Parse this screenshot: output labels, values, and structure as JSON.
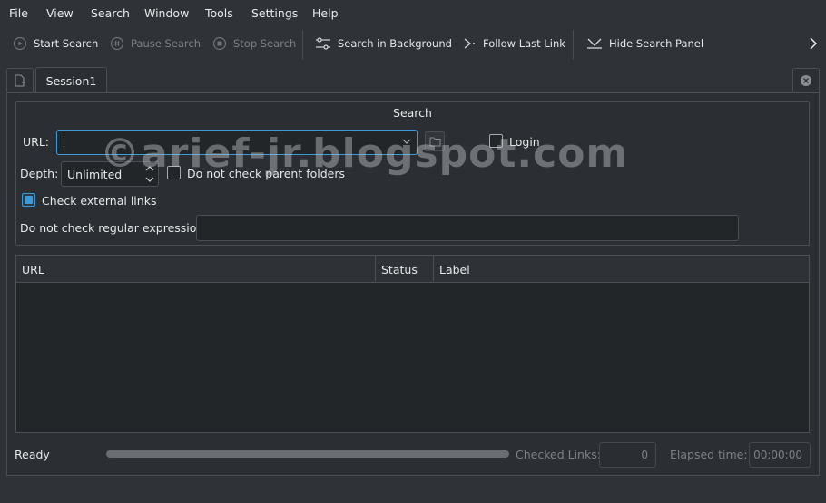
{
  "menu": [
    "File",
    "View",
    "Search",
    "Window",
    "Tools",
    "Settings",
    "Help"
  ],
  "toolbar": {
    "start_search": "Start Search",
    "pause_search": "Pause Search",
    "stop_search": "Stop Search",
    "search_background": "Search in Background",
    "follow_last_link": "Follow Last Link",
    "hide_search_panel": "Hide Search Panel"
  },
  "tabs": [
    {
      "label": "Session1",
      "active": true
    }
  ],
  "search": {
    "group_title": "Search",
    "url_label": "URL:",
    "url_value": "",
    "login_label": "Login",
    "login_checked": false,
    "depth_label": "Depth:",
    "depth_value": "Unlimited",
    "parent_folders_label": "Do not check parent folders",
    "parent_folders_checked": false,
    "external_links_label": "Check external links",
    "external_links_checked": true,
    "regex_label": "Do not check regular expression:",
    "regex_value": ""
  },
  "results": {
    "columns": [
      "URL",
      "Status",
      "Label"
    ],
    "rows": []
  },
  "status": {
    "state": "Ready",
    "progress_percent": 0,
    "checked_links_label": "Checked Links:",
    "checked_links_value": "0",
    "elapsed_label": "Elapsed time:",
    "elapsed_value": "00:00:00"
  },
  "watermark": "©arief-jr.blogspot.com",
  "colors": {
    "accent": "#3d9ad6",
    "background": "#2f3237"
  }
}
